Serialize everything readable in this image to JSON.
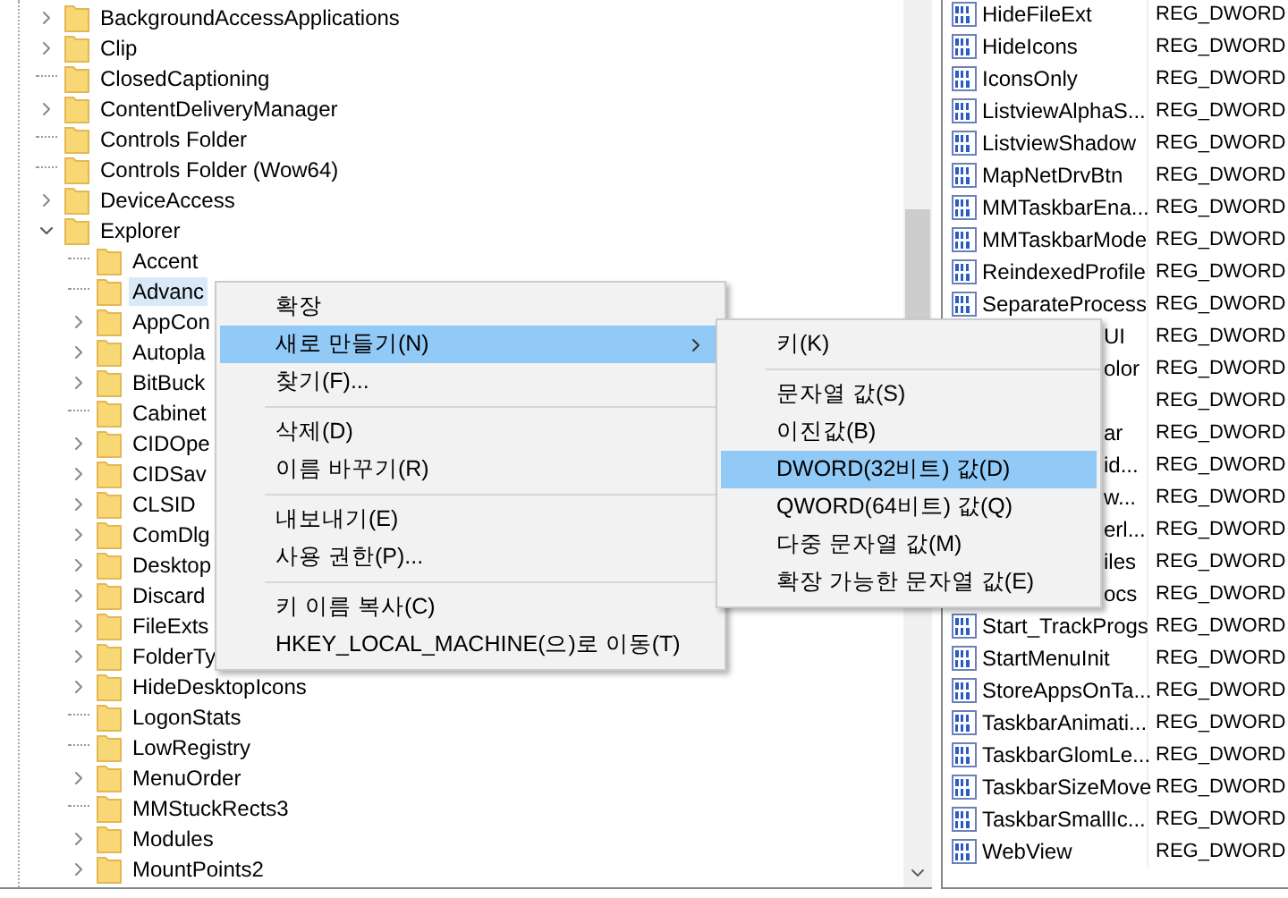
{
  "tree": [
    {
      "label": "BackgroundAccessApplications",
      "expandable": true,
      "expanded": false
    },
    {
      "label": "Clip",
      "expandable": true,
      "expanded": false
    },
    {
      "label": "ClosedCaptioning",
      "expandable": false
    },
    {
      "label": "ContentDeliveryManager",
      "expandable": true,
      "expanded": false
    },
    {
      "label": "Controls Folder",
      "expandable": false
    },
    {
      "label": "Controls Folder (Wow64)",
      "expandable": false
    },
    {
      "label": "DeviceAccess",
      "expandable": true,
      "expanded": false
    },
    {
      "label": "Explorer",
      "expandable": true,
      "expanded": true,
      "children": [
        {
          "label": "Accent",
          "expandable": false,
          "selected": false
        },
        {
          "label": "Advanc",
          "expandable": false,
          "selected": true
        },
        {
          "label": "AppCon",
          "expandable": true,
          "expanded": false,
          "selected": false
        },
        {
          "label": "Autopla",
          "expandable": true,
          "expanded": false,
          "selected": false
        },
        {
          "label": "BitBuck",
          "expandable": true,
          "expanded": false,
          "selected": false
        },
        {
          "label": "Cabinet",
          "expandable": false,
          "selected": false
        },
        {
          "label": "CIDOpe",
          "expandable": true,
          "expanded": false,
          "selected": false
        },
        {
          "label": "CIDSav",
          "expandable": true,
          "expanded": false,
          "selected": false
        },
        {
          "label": "CLSID",
          "expandable": true,
          "expanded": false,
          "selected": false
        },
        {
          "label": "ComDlg",
          "expandable": true,
          "expanded": false,
          "selected": false
        },
        {
          "label": "Desktop",
          "expandable": true,
          "expanded": false,
          "selected": false
        },
        {
          "label": "Discard",
          "expandable": true,
          "expanded": false,
          "selected": false
        },
        {
          "label": "FileExts",
          "expandable": true,
          "expanded": false,
          "selected": false
        },
        {
          "label": "FolderTy",
          "expandable": true,
          "expanded": false,
          "selected": false
        },
        {
          "label": "HideDesktopIcons",
          "expandable": true,
          "expanded": false,
          "selected": false
        },
        {
          "label": "LogonStats",
          "expandable": false,
          "selected": false
        },
        {
          "label": "LowRegistry",
          "expandable": false,
          "selected": false
        },
        {
          "label": "MenuOrder",
          "expandable": true,
          "expanded": false,
          "selected": false
        },
        {
          "label": "MMStuckRects3",
          "expandable": false,
          "selected": false
        },
        {
          "label": "Modules",
          "expandable": true,
          "expanded": false,
          "selected": false
        },
        {
          "label": "MountPoints2",
          "expandable": true,
          "expanded": false,
          "selected": false
        }
      ]
    }
  ],
  "values": [
    {
      "kind": "full",
      "name": "HideFileExt",
      "type": "REG_DWORD"
    },
    {
      "kind": "full",
      "name": "HideIcons",
      "type": "REG_DWORD"
    },
    {
      "kind": "full",
      "name": "IconsOnly",
      "type": "REG_DWORD"
    },
    {
      "kind": "full",
      "name": "ListviewAlphaS...",
      "type": "REG_DWORD"
    },
    {
      "kind": "full",
      "name": "ListviewShadow",
      "type": "REG_DWORD"
    },
    {
      "kind": "full",
      "name": "MapNetDrvBtn",
      "type": "REG_DWORD"
    },
    {
      "kind": "full",
      "name": "MMTaskbarEna...",
      "type": "REG_DWORD"
    },
    {
      "kind": "full",
      "name": "MMTaskbarMode",
      "type": "REG_DWORD"
    },
    {
      "kind": "full",
      "name": "ReindexedProfile",
      "type": "REG_DWORD"
    },
    {
      "kind": "full",
      "name": "SeparateProcess",
      "type": "REG_DWORD"
    },
    {
      "kind": "partial",
      "name": "UI",
      "type": "REG_DWORD"
    },
    {
      "kind": "partial",
      "name": "olor",
      "type": "REG_DWORD"
    },
    {
      "kind": "partial",
      "type": "REG_DWORD"
    },
    {
      "kind": "partial",
      "name": "ar",
      "type": "REG_DWORD"
    },
    {
      "kind": "partial",
      "name": "id...",
      "type": "REG_DWORD"
    },
    {
      "kind": "partial",
      "name": "w...",
      "type": "REG_DWORD"
    },
    {
      "kind": "partial",
      "name": "erl...",
      "type": "REG_DWORD"
    },
    {
      "kind": "partial",
      "name": "iles",
      "type": "REG_DWORD"
    },
    {
      "kind": "partial",
      "name": "ocs",
      "type": "REG_DWORD"
    },
    {
      "kind": "full",
      "name": "Start_TrackProgs",
      "type": "REG_DWORD"
    },
    {
      "kind": "full",
      "name": "StartMenuInit",
      "type": "REG_DWORD"
    },
    {
      "kind": "full",
      "name": "StoreAppsOnTa...",
      "type": "REG_DWORD"
    },
    {
      "kind": "full",
      "name": "TaskbarAnimati...",
      "type": "REG_DWORD"
    },
    {
      "kind": "full",
      "name": "TaskbarGlomLe...",
      "type": "REG_DWORD"
    },
    {
      "kind": "full",
      "name": "TaskbarSizeMove",
      "type": "REG_DWORD"
    },
    {
      "kind": "full",
      "name": "TaskbarSmallIc...",
      "type": "REG_DWORD"
    },
    {
      "kind": "full",
      "name": "WebView",
      "type": "REG_DWORD"
    }
  ],
  "context_menu": [
    {
      "kind": "item",
      "label": "확장",
      "selected": false,
      "submenu": false
    },
    {
      "kind": "item",
      "label": "새로 만들기(N)",
      "selected": true,
      "submenu": true
    },
    {
      "kind": "item",
      "label": "찾기(F)...",
      "selected": false,
      "submenu": false
    },
    {
      "kind": "separator"
    },
    {
      "kind": "item",
      "label": "삭제(D)",
      "selected": false,
      "submenu": false
    },
    {
      "kind": "item",
      "label": "이름 바꾸기(R)",
      "selected": false,
      "submenu": false
    },
    {
      "kind": "separator"
    },
    {
      "kind": "item",
      "label": "내보내기(E)",
      "selected": false,
      "submenu": false
    },
    {
      "kind": "item",
      "label": "사용 권한(P)...",
      "selected": false,
      "submenu": false
    },
    {
      "kind": "separator"
    },
    {
      "kind": "item",
      "label": "키 이름 복사(C)",
      "selected": false,
      "submenu": false
    },
    {
      "kind": "item",
      "label": "HKEY_LOCAL_MACHINE(으)로 이동(T)",
      "selected": false,
      "submenu": false
    }
  ],
  "submenu": [
    {
      "kind": "item",
      "label": "키(K)",
      "selected": false
    },
    {
      "kind": "separator"
    },
    {
      "kind": "item",
      "label": "문자열 값(S)",
      "selected": false
    },
    {
      "kind": "item",
      "label": "이진값(B)",
      "selected": false
    },
    {
      "kind": "item",
      "label": "DWORD(32비트) 값(D)",
      "selected": true
    },
    {
      "kind": "item",
      "label": "QWORD(64비트) 값(Q)",
      "selected": false
    },
    {
      "kind": "item",
      "label": "다중 문자열 값(M)",
      "selected": false
    },
    {
      "kind": "item",
      "label": "확장 가능한 문자열 값(E)",
      "selected": false
    }
  ]
}
